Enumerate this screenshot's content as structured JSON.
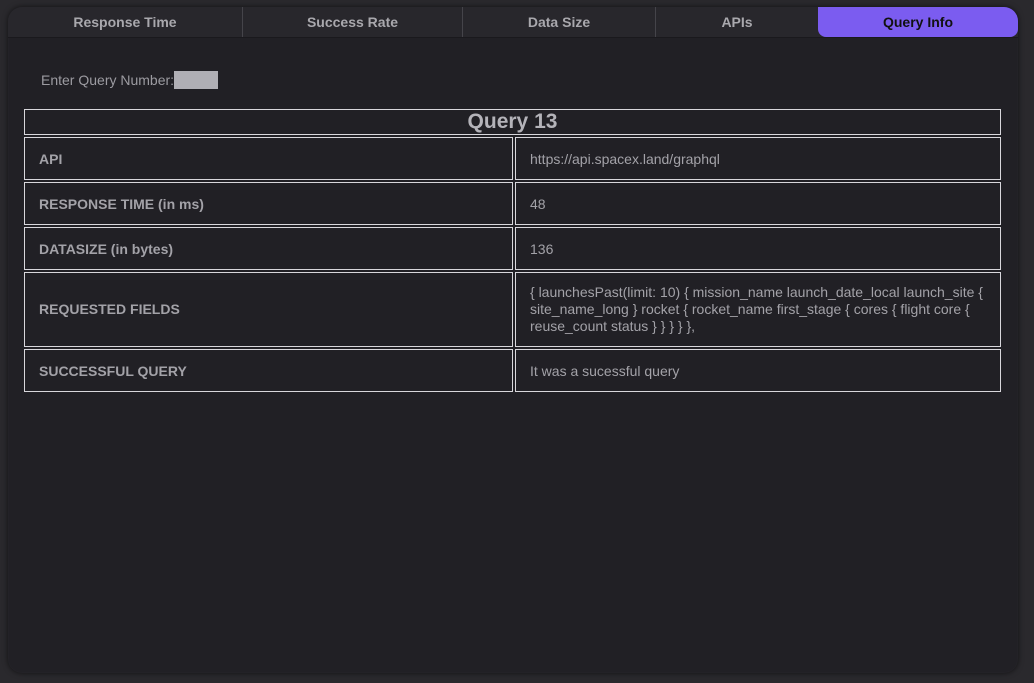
{
  "tabs": [
    {
      "label": "Response Time"
    },
    {
      "label": "Success Rate"
    },
    {
      "label": "Data Size"
    },
    {
      "label": "APIs"
    },
    {
      "label": "Query Info",
      "active": true
    }
  ],
  "accent_color": "#7b5cf0",
  "query": {
    "label": "Enter Query Number:",
    "value": ""
  },
  "table": {
    "title": "Query 13",
    "rows": [
      {
        "key": "API",
        "value": "https://api.spacex.land/graphql"
      },
      {
        "key": "RESPONSE TIME (in ms)",
        "value": "48"
      },
      {
        "key": "DATASIZE (in bytes)",
        "value": "136"
      },
      {
        "key": "REQUESTED FIELDS",
        "value": "{ launchesPast(limit: 10) { mission_name launch_date_local launch_site { site_name_long } rocket { rocket_name first_stage { cores { flight core { reuse_count status } } } } },"
      },
      {
        "key": "SUCCESSFUL QUERY",
        "value": "It was a sucessful query"
      }
    ]
  }
}
